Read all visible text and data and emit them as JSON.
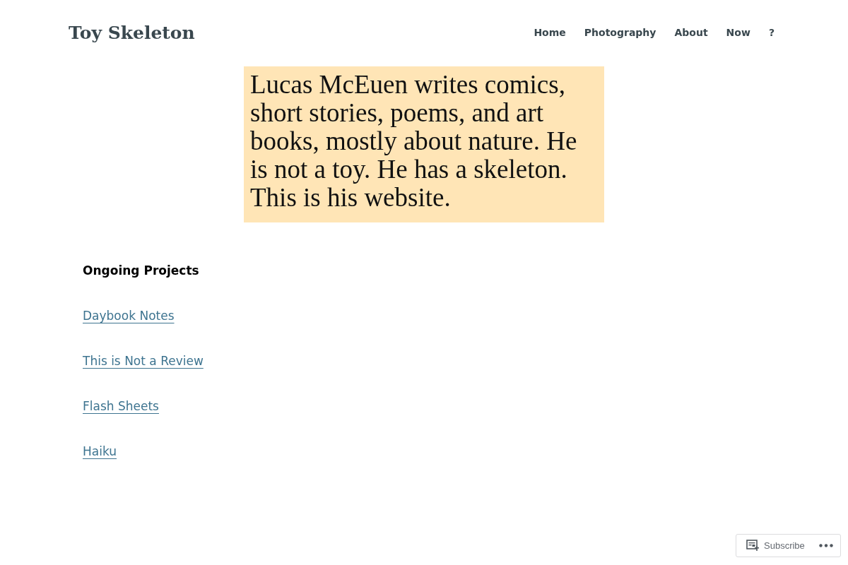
{
  "header": {
    "site_title": "Toy Skeleton",
    "nav": [
      {
        "label": "Home"
      },
      {
        "label": "Photography"
      },
      {
        "label": "About"
      },
      {
        "label": "Now"
      },
      {
        "label": "?"
      }
    ]
  },
  "intro": {
    "text": "Lucas McEuen writes comics, short stories, poems, and art books, mostly about nature. He is not a toy. He has a skeleton. This is his website."
  },
  "projects": {
    "heading": "Ongoing Projects",
    "links": [
      "Daybook Notes",
      "This is Not a Review",
      "Flash Sheets",
      "Haiku"
    ]
  },
  "subscribe_bar": {
    "label": "Subscribe"
  }
}
